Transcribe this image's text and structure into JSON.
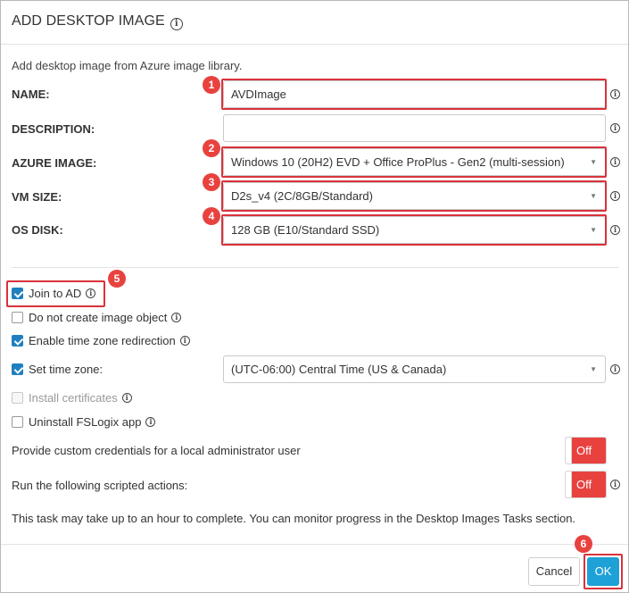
{
  "dialog": {
    "title": "ADD DESKTOP IMAGE",
    "subtitle": "Add desktop image from Azure image library.",
    "info_glyph": "i"
  },
  "form": {
    "name": {
      "label": "NAME:",
      "value": "AVDImage"
    },
    "description": {
      "label": "DESCRIPTION:",
      "value": ""
    },
    "azure_image": {
      "label": "AZURE IMAGE:",
      "value": "Windows 10 (20H2) EVD + Office ProPlus - Gen2 (multi-session)"
    },
    "vm_size": {
      "label": "VM SIZE:",
      "value": "D2s_v4 (2C/8GB/Standard)"
    },
    "os_disk": {
      "label": "OS DISK:",
      "value": "128 GB (E10/Standard SSD)"
    }
  },
  "options": {
    "join_ad": {
      "label": "Join to AD",
      "checked": true
    },
    "no_image_object": {
      "label": "Do not create image object",
      "checked": false
    },
    "tz_redirection": {
      "label": "Enable time zone redirection",
      "checked": true
    },
    "set_tz": {
      "label": "Set time zone:",
      "checked": true,
      "value": "(UTC-06:00) Central Time (US & Canada)"
    },
    "install_certs": {
      "label": "Install certificates",
      "checked": false,
      "disabled": true
    },
    "uninstall_fslogix": {
      "label": "Uninstall FSLogix app",
      "checked": false
    }
  },
  "toggles": {
    "custom_credentials": {
      "label": "Provide custom credentials for a local administrator user",
      "state": "Off"
    },
    "scripted_actions": {
      "label": "Run the following scripted actions:",
      "state": "Off"
    }
  },
  "note": "This task may take up to an hour to complete. You can monitor progress in the Desktop Images Tasks section.",
  "buttons": {
    "cancel": "Cancel",
    "ok": "OK"
  },
  "callouts": [
    "1",
    "2",
    "3",
    "4",
    "5",
    "6"
  ],
  "colors": {
    "accent": "#1ea1d6",
    "highlight": "#d9323b",
    "toggle_off": "#e8423f",
    "checkbox": "#1f7fbf"
  },
  "icons": {
    "info": "info-circle-icon",
    "dropdown": "caret-down-icon",
    "check": "checkmark-icon"
  }
}
